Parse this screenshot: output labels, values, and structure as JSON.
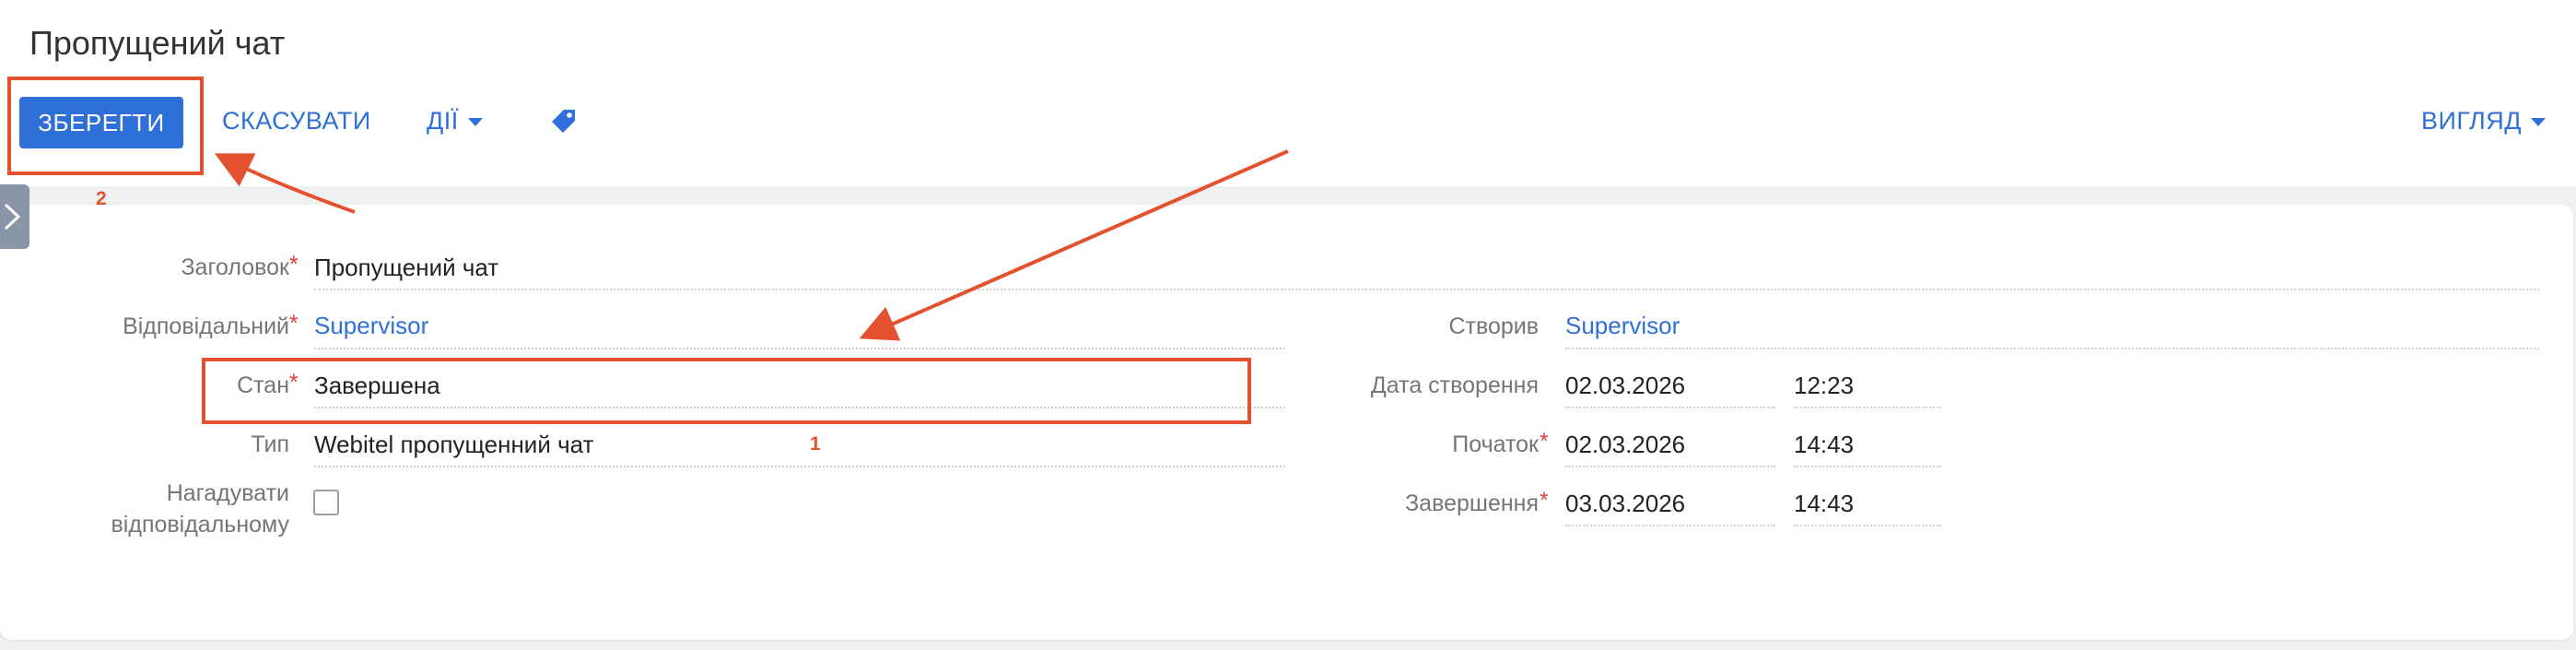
{
  "page": {
    "title": "Пропущений чат"
  },
  "toolbar": {
    "save_label": "ЗБЕРЕГТИ",
    "cancel_label": "СКАСУВАТИ",
    "actions_label": "ДІЇ",
    "view_label": "ВИГЛЯД",
    "tag_icon": "tag-icon"
  },
  "form": {
    "title": {
      "label": "Заголовок",
      "value": "Пропущений чат",
      "required": true
    },
    "owner": {
      "label": "Відповідальний",
      "value": "Supervisor",
      "required": true
    },
    "status": {
      "label": "Стан",
      "value": "Завершена",
      "required": true
    },
    "type": {
      "label": "Тип",
      "value": "Webitel пропущенний чат"
    },
    "remind": {
      "label_line1": "Нагадувати",
      "label_line2": "відповідальному",
      "checked": false
    },
    "created_by": {
      "label": "Створив",
      "value": "Supervisor"
    },
    "created_on": {
      "label": "Дата створення",
      "date": "02.03.2026",
      "time": "12:23"
    },
    "start": {
      "label": "Початок",
      "date": "02.03.2026",
      "time": "14:43",
      "required": true
    },
    "end": {
      "label": "Завершення",
      "date": "03.03.2026",
      "time": "14:43",
      "required": true
    },
    "required_mark": "*"
  },
  "annotations": {
    "marker1": "1",
    "marker2": "2",
    "color": "#e4512f"
  },
  "colors": {
    "accent": "#2e6fd8",
    "required": "#e0413a"
  }
}
